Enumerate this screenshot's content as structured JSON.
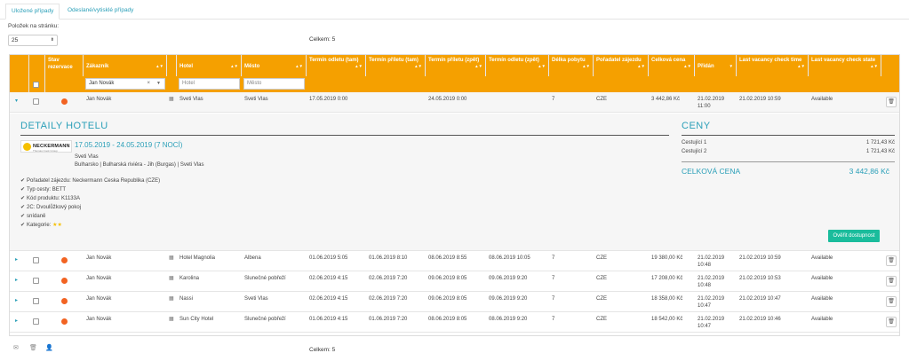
{
  "tabs": [
    {
      "label": "Uložené případy"
    },
    {
      "label": "Odeslané/vytisklé případy"
    }
  ],
  "per_page": {
    "label": "Položek na stránku:",
    "value": "25"
  },
  "total": {
    "label": "Celkem:",
    "value": "5"
  },
  "columns": {
    "stav": "Stav rezervace",
    "zakaznik": "Zákazník",
    "hotel": "Hotel",
    "mesto": "Město",
    "odletu_tam": "Termín odletu (tam)",
    "priletu_tam": "Termín příletu (tam)",
    "priletu_zpet": "Termín příletu (zpět)",
    "odletu_zpet": "Termín odletu (zpět)",
    "delka": "Délka pobytu",
    "poradatel": "Pořadatel zájezdu",
    "cena": "Celková cena",
    "pridan": "Přidán",
    "lv_time": "Last vacancy check time",
    "lv_state": "Last vacancy check state"
  },
  "filters": {
    "zakaznik": "Jan Novák",
    "hotel_placeholder": "Hotel",
    "mesto_placeholder": "Město"
  },
  "rows": [
    {
      "customer": "Jan Novák",
      "hotel": "Sveti Vlas",
      "city": "Sveti Vlas",
      "dep_out": "17.05.2019 0:00",
      "arr_out": "",
      "arr_back": "24.05.2019 0:00",
      "dep_back": "",
      "length": "7",
      "organizer": "CZE",
      "price": "3 442,86 Kč",
      "added1": "21.02.2019",
      "added2": "11:00",
      "lv_time": "21.02.2019 10:59",
      "lv_state": "Available"
    },
    {
      "customer": "Jan Novák",
      "hotel": "Hotel Magnolia",
      "city": "Albena",
      "dep_out": "01.06.2019 5:05",
      "arr_out": "01.06.2019 8:10",
      "arr_back": "08.06.2019 8:55",
      "dep_back": "08.06.2019 10:05",
      "length": "7",
      "organizer": "CZE",
      "price": "19 380,00 Kč",
      "added1": "21.02.2019",
      "added2": "10:48",
      "lv_time": "21.02.2019 10:59",
      "lv_state": "Available"
    },
    {
      "customer": "Jan Novák",
      "hotel": "Karolina",
      "city": "Slunečné pobřeží",
      "dep_out": "02.06.2019 4:15",
      "arr_out": "02.06.2019 7:20",
      "arr_back": "09.06.2019 8:05",
      "dep_back": "09.06.2019 9:20",
      "length": "7",
      "organizer": "CZE",
      "price": "17 208,00 Kč",
      "added1": "21.02.2019",
      "added2": "10:48",
      "lv_time": "21.02.2019 10:53",
      "lv_state": "Available"
    },
    {
      "customer": "Jan Novák",
      "hotel": "Nassi",
      "city": "Sveti Vlas",
      "dep_out": "02.06.2019 4:15",
      "arr_out": "02.06.2019 7:20",
      "arr_back": "09.06.2019 8:05",
      "dep_back": "09.06.2019 9:20",
      "length": "7",
      "organizer": "CZE",
      "price": "18 358,00 Kč",
      "added1": "21.02.2019",
      "added2": "10:47",
      "lv_time": "21.02.2019 10:47",
      "lv_state": "Available"
    },
    {
      "customer": "Jan Novák",
      "hotel": "Sun City Hotel",
      "city": "Slunečné pobřeží",
      "dep_out": "01.06.2019 4:15",
      "arr_out": "01.06.2019 7:20",
      "arr_back": "08.06.2019 8:05",
      "dep_back": "08.06.2019 9:20",
      "length": "7",
      "organizer": "CZE",
      "price": "18 542,00 Kč",
      "added1": "21.02.2019",
      "added2": "10:47",
      "lv_time": "21.02.2019 10:46",
      "lv_state": "Available"
    }
  ],
  "detail": {
    "title": "DETAILY HOTELU",
    "logo_text": "NECKERMANN",
    "logo_sub": "Thomas Cook Group",
    "dates": "17.05.2019 - 24.05.2019 (7 NOCÍ)",
    "hotel_name": "Sveti Vlas",
    "location": "Bulharsko | Bulharská riviéra - Jih (Burgas) | Sveti Vlas",
    "features": [
      "Pořadatel zájezdu: Neckermann Ceska Republika (CZE)",
      "Typ cesty: BETT",
      "Kód produktu: K1133A",
      "2C: Dvoulůžkový pokoj",
      "snídaně",
      "Kategorie:"
    ],
    "stars": "★★",
    "prices_title": "CENY",
    "travelers": [
      {
        "label": "Cestující 1",
        "value": "1 721,43 Kč"
      },
      {
        "label": "Cestující 2",
        "value": "1 721,43 Kč"
      }
    ],
    "total_label": "CELKOVÁ CENA",
    "total_value": "3 442,86 Kč",
    "verify_label": "Ověřit dostupnost"
  },
  "colors": {
    "header": "#f5a000",
    "accent": "#2a9fb8",
    "status_dot": "#f26322",
    "verify": "#1abc9c"
  }
}
